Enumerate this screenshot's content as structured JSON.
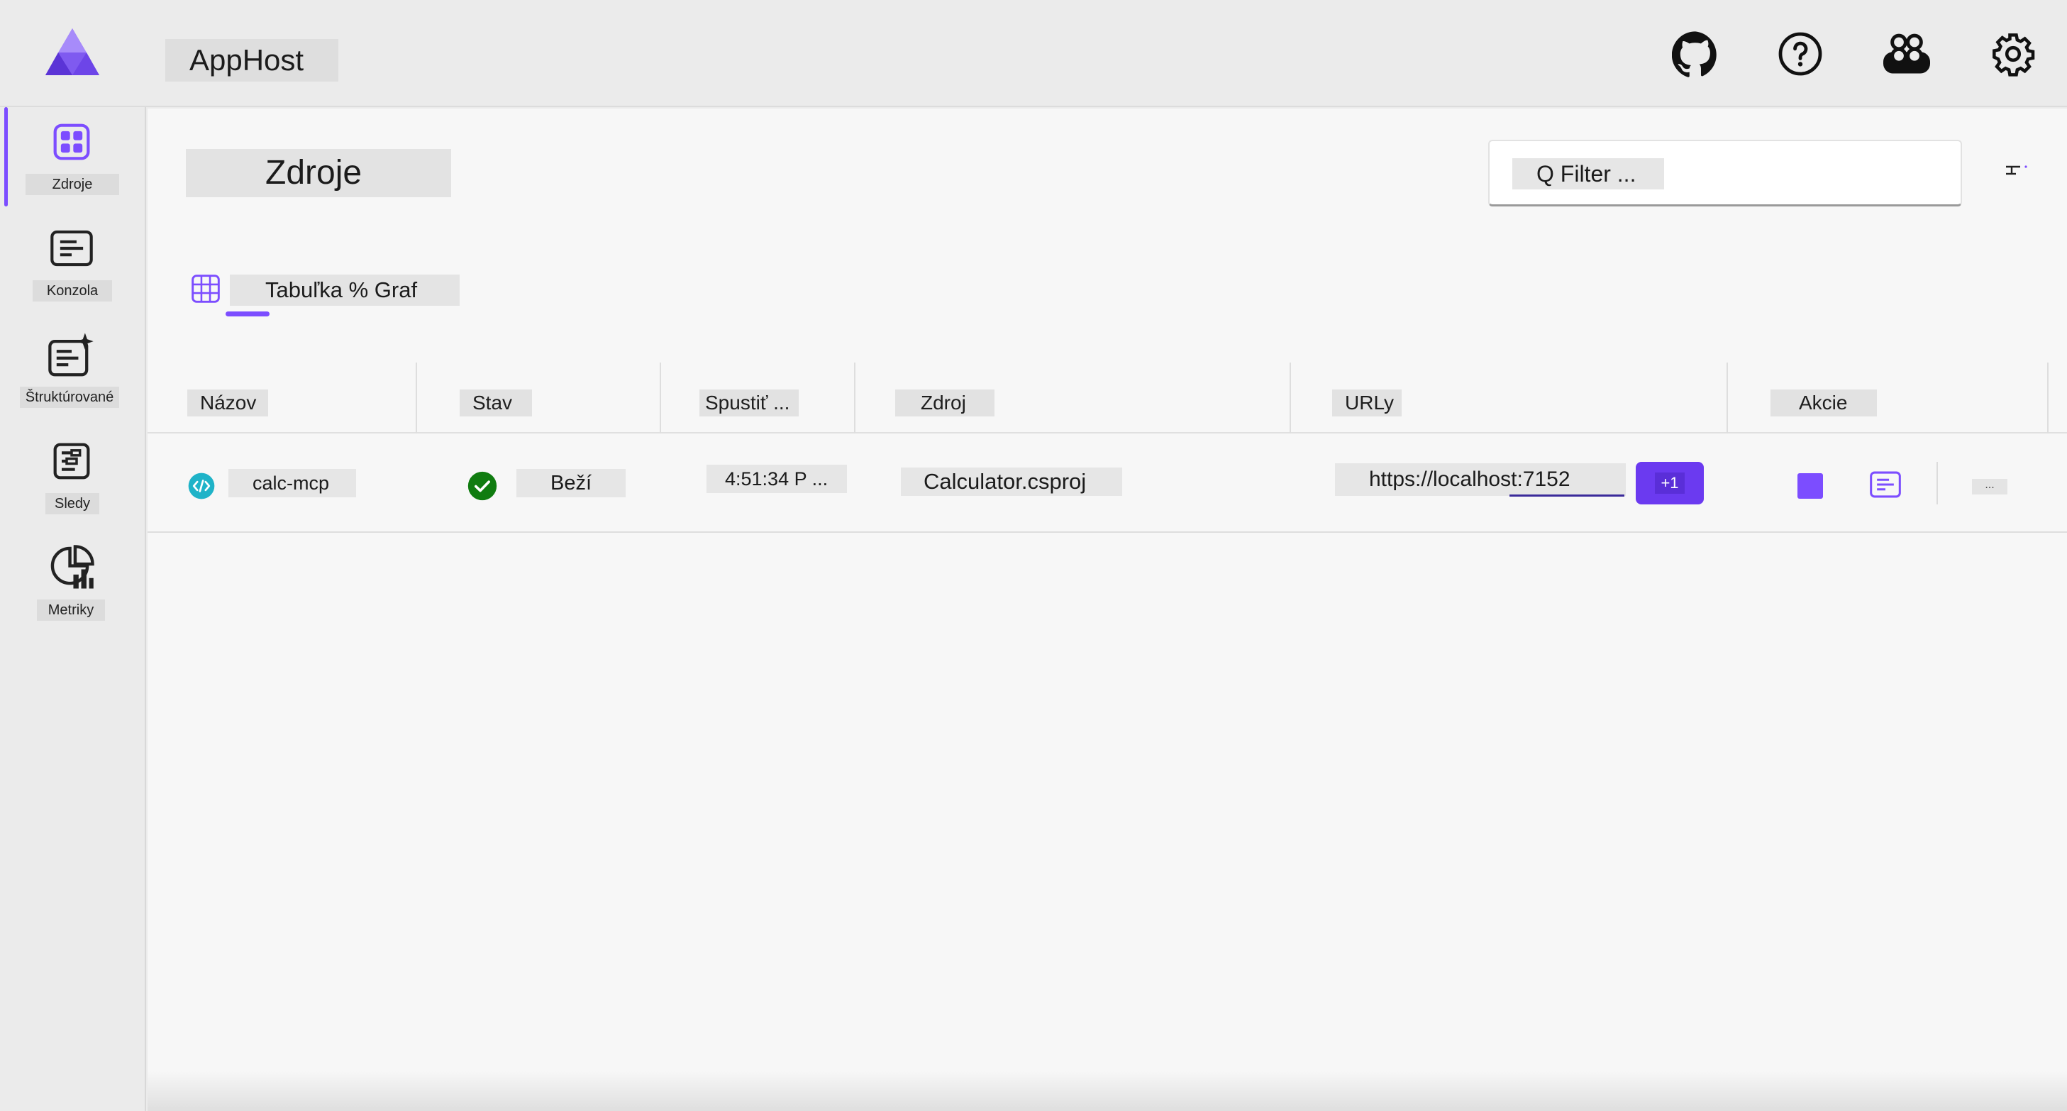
{
  "header": {
    "app_title": "AppHost",
    "icons": [
      "github-icon",
      "help-icon",
      "aspire-copilot-icon",
      "settings-icon"
    ]
  },
  "sidenav": {
    "items": [
      {
        "label": "Zdroje",
        "icon": "resources-grid-icon",
        "active": true
      },
      {
        "label": "Konzola",
        "icon": "console-icon",
        "active": false
      },
      {
        "label": "Štruktúrované",
        "icon": "structured-logs-icon",
        "active": false
      },
      {
        "label": "Sledy",
        "icon": "traces-icon",
        "active": false
      },
      {
        "label": "Metriky",
        "icon": "metrics-icon",
        "active": false
      }
    ]
  },
  "main": {
    "title": "Zdroje",
    "filter": {
      "placeholder": "Q Filter ..."
    },
    "view_tabs_label": "Tabuľka % Graf",
    "table": {
      "columns": [
        "Názov",
        "Stav",
        "Spustiť ...",
        "Zdroj",
        "URLy",
        "Akcie"
      ],
      "rows": [
        {
          "name": "calc-mcp",
          "state": "Beží",
          "start_time": "4:51:34 P ...",
          "source": "Calculator.csproj",
          "url": "https://localhost:7152",
          "extra_urls": "+1",
          "more": "..."
        }
      ]
    }
  },
  "colors": {
    "accent": "#7c4dff",
    "running": "#107c10",
    "project_icon": "#1fb3c8"
  }
}
